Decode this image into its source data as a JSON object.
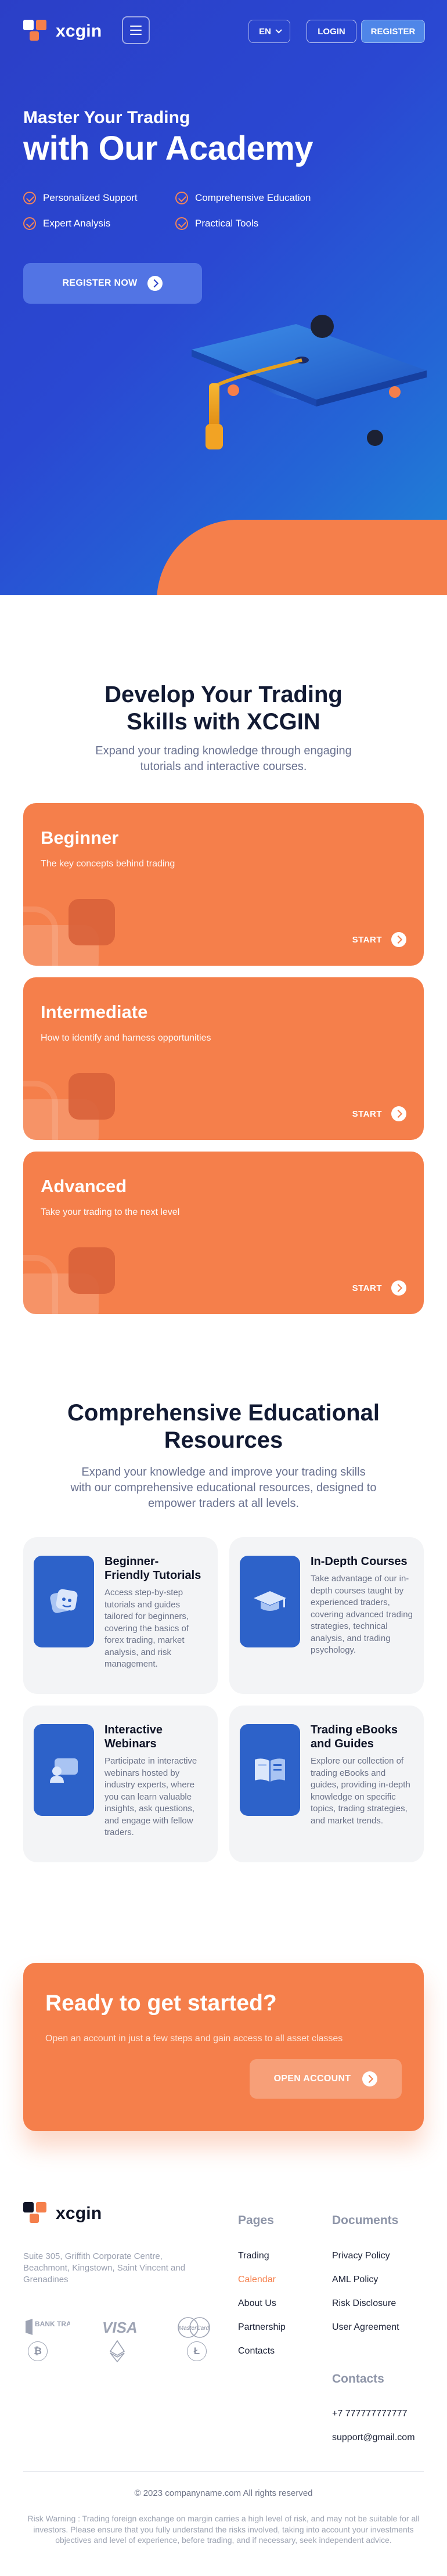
{
  "header": {
    "logo_text": "xcgin",
    "language": "EN",
    "login_label": "LOGIN",
    "register_label": "REGISTER"
  },
  "hero": {
    "subtitle": "Master Your Trading",
    "title": "with Our Academy",
    "features": [
      "Personalized Support",
      "Comprehensive Education",
      "Expert Analysis",
      "Practical Tools"
    ],
    "cta_label": "REGISTER NOW"
  },
  "skills": {
    "title_line1": "Develop Your Trading",
    "title_line2": "Skills with XCGIN",
    "desc_line1": "Expand your trading knowledge through engaging",
    "desc_line2": "tutorials and interactive courses.",
    "levels": [
      {
        "title": "Beginner",
        "desc": "The key concepts behind trading",
        "action": "START"
      },
      {
        "title": "Intermediate",
        "desc": "How to identify and harness opportunities",
        "action": "START"
      },
      {
        "title": "Advanced",
        "desc": "Take your trading to the next level",
        "action": "START"
      }
    ]
  },
  "resources": {
    "title_line1": "Comprehensive Educational",
    "title_line2": "Resources",
    "desc_line1": "Expand your knowledge and improve your trading skills",
    "desc_line2": "with our comprehensive educational resources, designed to",
    "desc_line3": "empower traders at all levels.",
    "cards": [
      {
        "title_line1": "Beginner-",
        "title_line2": "Friendly Tutorials",
        "text": "Access step-by-step tutorials and guides tailored for beginners, covering the basics of forex trading, market analysis, and risk management."
      },
      {
        "title_line1": "In-Depth Courses",
        "title_line2": "",
        "text": "Take advantage of our in-depth courses taught by experienced traders, covering advanced trading strategies, technical analysis, and trading psychology."
      },
      {
        "title_line1": "Interactive",
        "title_line2": "Webinars",
        "text": "Participate in interactive webinars hosted by industry experts, where you can learn valuable insights, ask questions, and engage with fellow traders."
      },
      {
        "title_line1": "Trading eBooks",
        "title_line2": "and Guides",
        "text": "Explore our collection of trading eBooks and guides, providing in-depth knowledge on specific topics, trading strategies, and market trends."
      }
    ]
  },
  "ready": {
    "title": "Ready to get started?",
    "text": "Open an account in just a few steps and gain access to all asset classes",
    "button_label": "OPEN ACCOUNT"
  },
  "footer": {
    "logo_text": "xcgin",
    "address": "Suite 305, Griffith Corporate Centre, Beachmont, Kingstown, Saint Vincent and Grenadines",
    "payments": [
      "BANK TRANSFER",
      "VISA",
      "MasterCard"
    ],
    "pages_title": "Pages",
    "pages": [
      "Trading",
      "Calendar",
      "About Us",
      "Partnership",
      "Contacts"
    ],
    "documents_title": "Documents",
    "documents": [
      "Privacy Policy",
      "AML Policy",
      "Risk Disclosure",
      "User Agreement"
    ],
    "contacts_title": "Contacts",
    "phone": "+7 777777777777",
    "email": "support@gmail.com",
    "copyright": "© 2023 companyname.com All rights reserved",
    "risk_warning": "Risk Warning : Trading foreign exchange on margin carries a high level of risk, and may not be suitable for all investors. Please ensure that you fully understand the risks involved, taking into account your investments objectives and level of experience, before trading, and if necessary, seek independent advice."
  },
  "colors": {
    "accent_orange": "#f57f4b",
    "hero_blue": "#2b3fc7",
    "icon_blue": "#2d62c9"
  }
}
